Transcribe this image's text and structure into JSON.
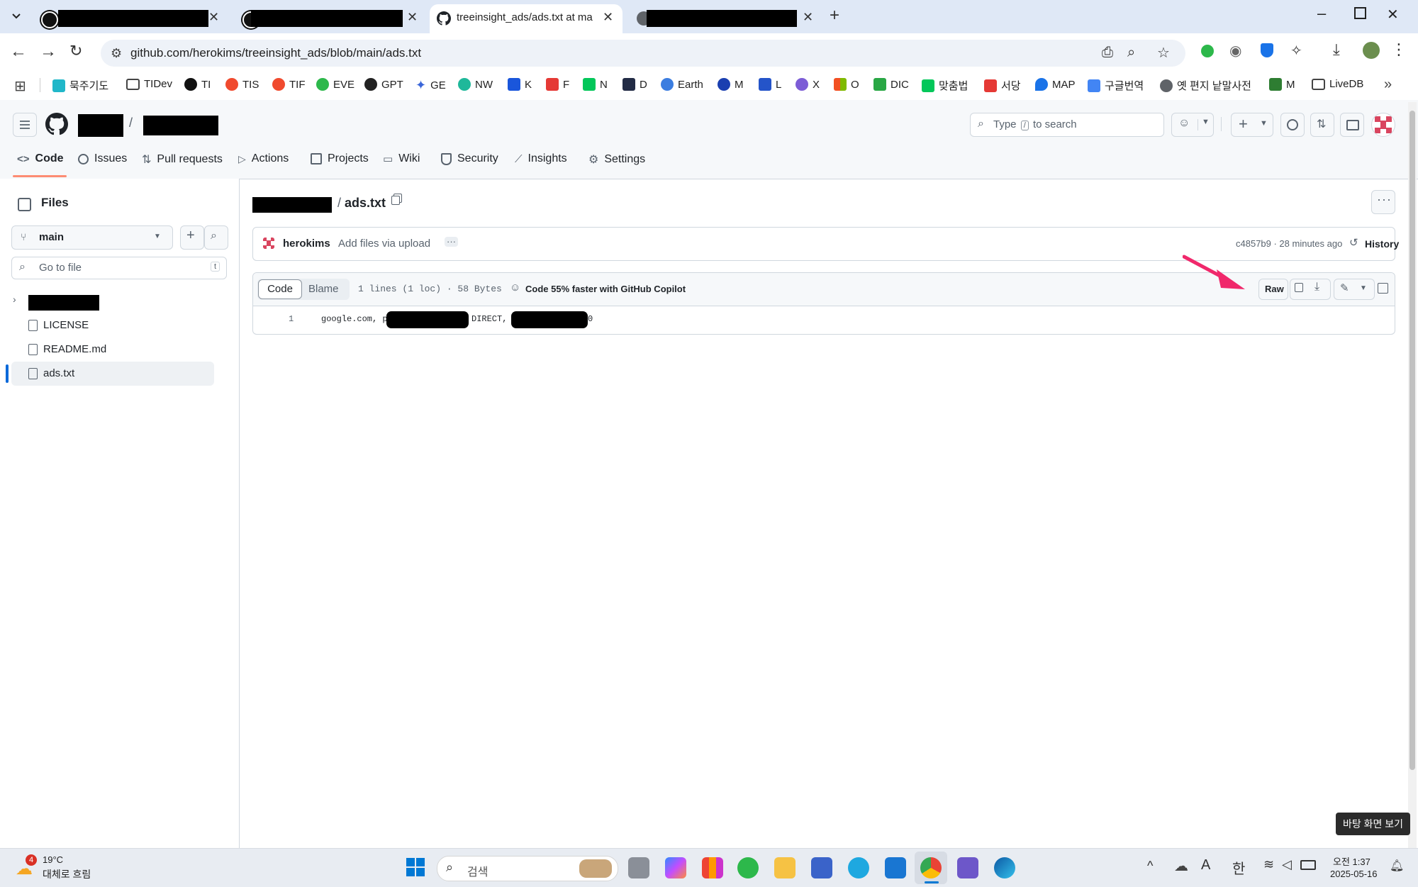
{
  "browser": {
    "tabs": [
      {
        "title": "",
        "redacted": true
      },
      {
        "title": "",
        "redacted": true
      },
      {
        "title": "treeinsight_ads/ads.txt at main",
        "active": true
      },
      {
        "title": "",
        "redacted": true
      }
    ],
    "new_tab": "+",
    "url": "github.com/herokims/treeinsight_ads/blob/main/ads.txt",
    "bookmarks": [
      "묵주기도",
      "TIDev",
      "TI",
      "TIS",
      "TIF",
      "EVE",
      "GPT",
      "GE",
      "NW",
      "K",
      "F",
      "N",
      "D",
      "Earth",
      "M",
      "L",
      "X",
      "O",
      "DIC",
      "맞춤법",
      "서당",
      "MAP",
      "구글번역",
      "옛 편지 낱말사전",
      "M",
      "LiveDB"
    ]
  },
  "github": {
    "breadcrumb_sep": "/",
    "search_placeholder_pre": "Type",
    "search_key": "/",
    "search_placeholder_post": "to search",
    "nav_tabs": [
      "Code",
      "Issues",
      "Pull requests",
      "Actions",
      "Projects",
      "Wiki",
      "Security",
      "Insights",
      "Settings"
    ]
  },
  "sidebar": {
    "title": "Files",
    "branch": "main",
    "goto_placeholder": "Go to file",
    "goto_shortcut": "t",
    "files": [
      "LICENSE",
      "README.md",
      "ads.txt"
    ],
    "selected_file": "ads.txt"
  },
  "file": {
    "path_sep": "/",
    "name": "ads.txt",
    "commit_author": "herokims",
    "commit_message": "Add files via upload",
    "commit_meta": "c4857b9 · 28 minutes ago",
    "history_label": "History",
    "view_tabs": [
      "Code",
      "Blame"
    ],
    "stats": "1 lines (1 loc) · 58 Bytes",
    "copilot_text": "Code 55% faster with GitHub Copilot",
    "raw_label": "Raw",
    "line_number": "1",
    "line_part1": "google.com, pub-4",
    "line_part2": "DIRECT,",
    "line_part3": "0"
  },
  "taskbar": {
    "weather_badge": "4",
    "temperature": "19°C",
    "weather_desc": "대체로 흐림",
    "search_label": "검색",
    "ime_a": "A",
    "ime_han": "한",
    "time": "오전 1:37",
    "date": "2025-05-16",
    "tooltip": "바탕 화면 보기"
  },
  "colors": {
    "tabbar": "#dfe8f6",
    "accent_orange": "#fd8c73",
    "arrow": "#f0286b",
    "link_blue": "#0969da"
  }
}
